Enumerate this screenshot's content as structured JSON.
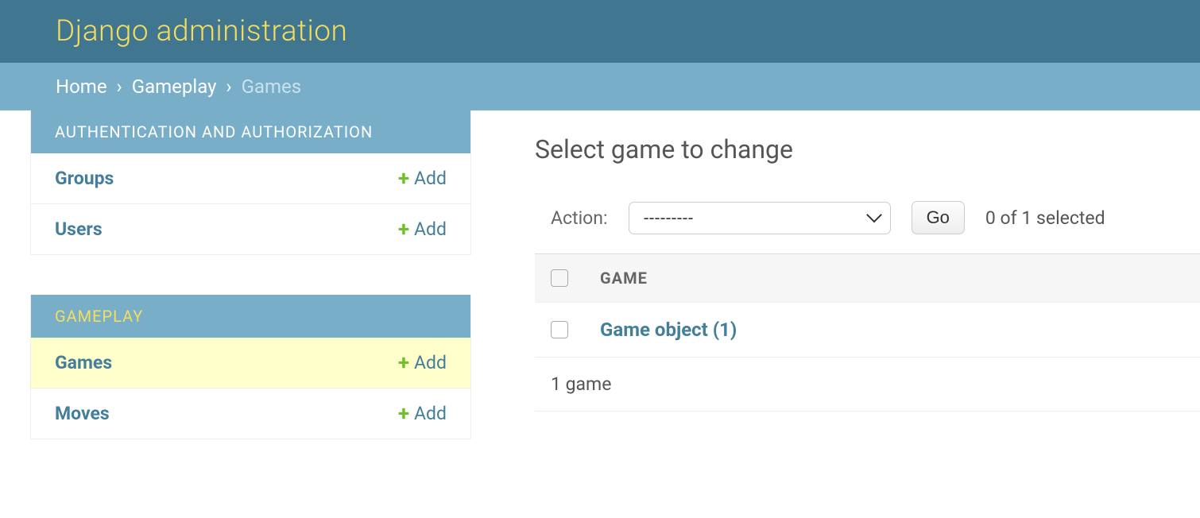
{
  "header": {
    "title": "Django administration"
  },
  "breadcrumbs": {
    "home": "Home",
    "app": "Gameplay",
    "model": "Games",
    "sep": "›"
  },
  "sidebar": {
    "sections": [
      {
        "caption": "AUTHENTICATION AND AUTHORIZATION",
        "active": false,
        "rows": [
          {
            "label": "Groups",
            "add": "Add",
            "selected": false
          },
          {
            "label": "Users",
            "add": "Add",
            "selected": false
          }
        ]
      },
      {
        "caption": "GAMEPLAY",
        "active": true,
        "rows": [
          {
            "label": "Games",
            "add": "Add",
            "selected": true
          },
          {
            "label": "Moves",
            "add": "Add",
            "selected": false
          }
        ]
      }
    ]
  },
  "content": {
    "heading": "Select game to change",
    "action_label": "Action:",
    "action_select_default": "---------",
    "go_label": "Go",
    "selection_counter": "0 of 1 selected",
    "column_header": "GAME",
    "rows": [
      {
        "label": "Game object (1)"
      }
    ],
    "paginator": "1 game"
  }
}
